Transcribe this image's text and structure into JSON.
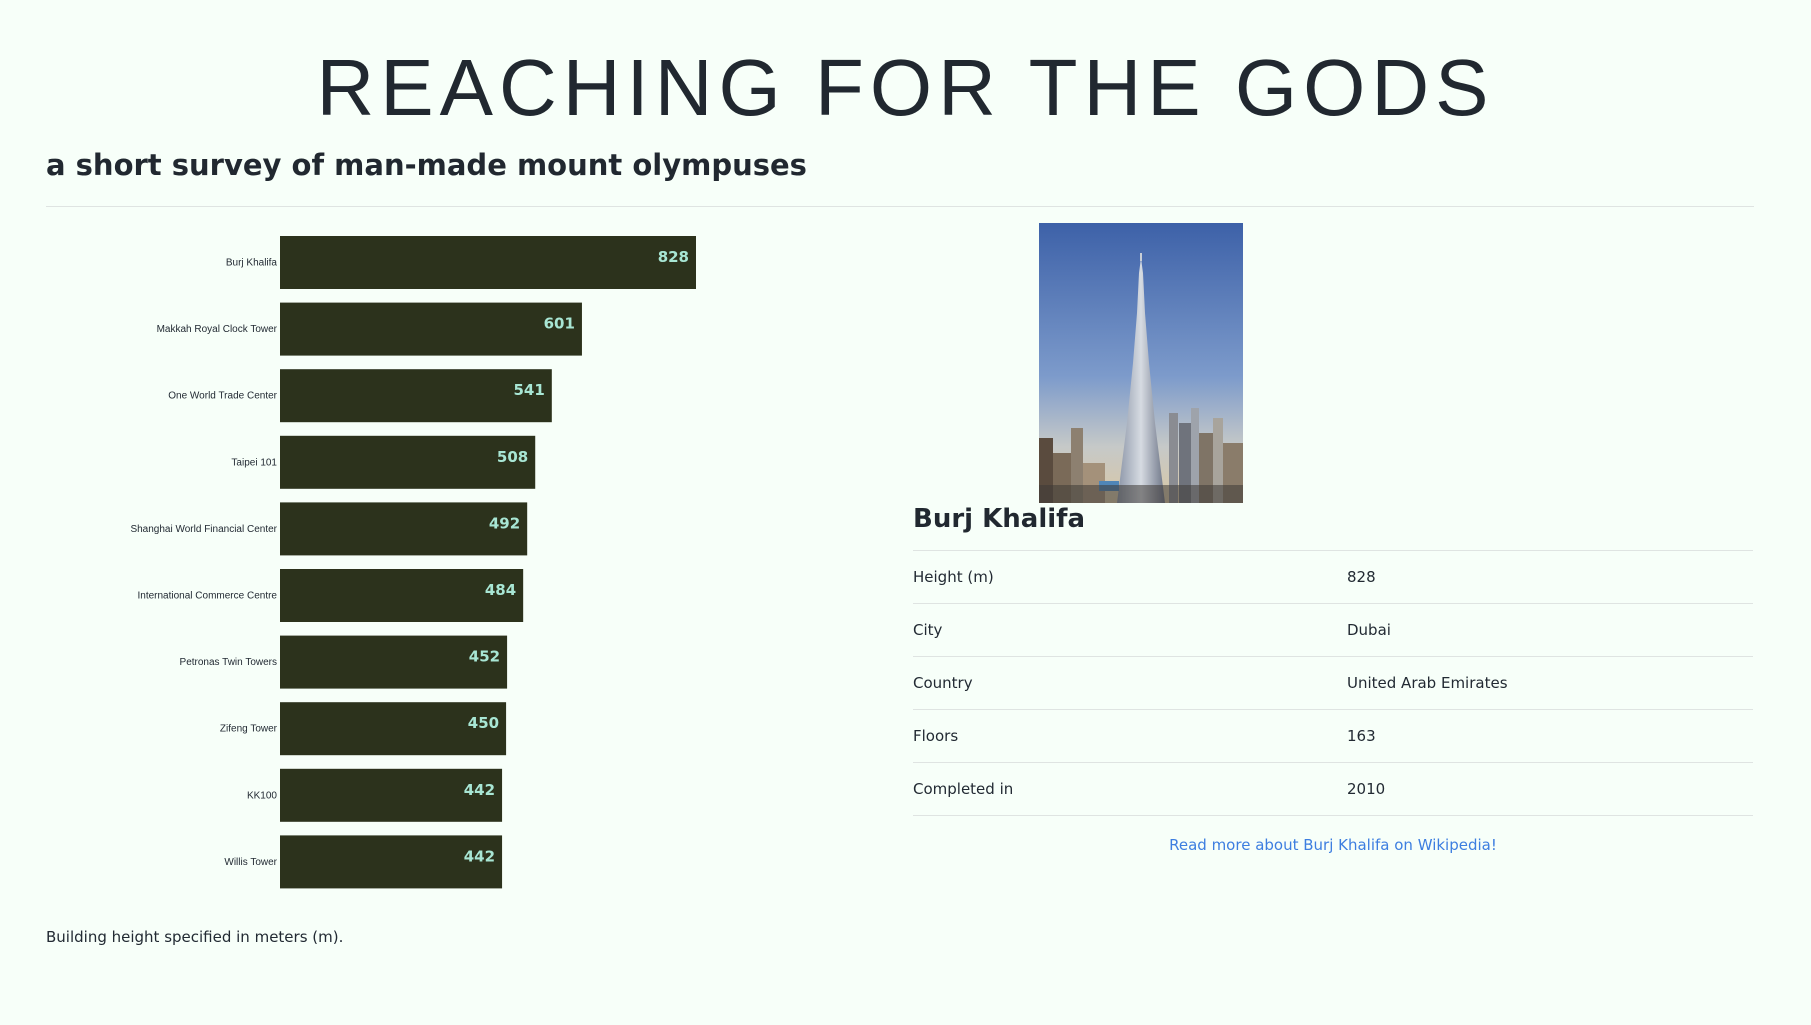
{
  "header": {
    "title": "REACHING FOR THE GODS",
    "subtitle": "a short survey of man-made mount olympuses"
  },
  "chart_data": {
    "type": "bar",
    "orientation": "horizontal",
    "categories": [
      "Burj Khalifa",
      "Makkah Royal Clock Tower",
      "One World Trade Center",
      "Taipei 101",
      "Shanghai World Financial Center",
      "International Commerce Centre",
      "Petronas Twin Towers",
      "Zifeng Tower",
      "KK100",
      "Willis Tower"
    ],
    "values": [
      828,
      601,
      541,
      508,
      492,
      484,
      452,
      450,
      442,
      442
    ],
    "title": "",
    "xlabel": "",
    "ylabel": "",
    "grid": false,
    "data_labels": true,
    "colors": {
      "bar": "#2c321c",
      "label": "#a8e6d4"
    }
  },
  "footnote": "Building height specified in meters (m).",
  "detail": {
    "name": "Burj Khalifa",
    "rows": [
      {
        "key": "Height (m)",
        "value": "828"
      },
      {
        "key": "City",
        "value": "Dubai"
      },
      {
        "key": "Country",
        "value": "United Arab Emirates"
      },
      {
        "key": "Floors",
        "value": "163"
      },
      {
        "key": "Completed in",
        "value": "2010"
      }
    ],
    "link_text": "Read more about Burj Khalifa on Wikipedia!"
  },
  "colors": {
    "background": "#f7fff9",
    "link": "#3d7ee0"
  }
}
